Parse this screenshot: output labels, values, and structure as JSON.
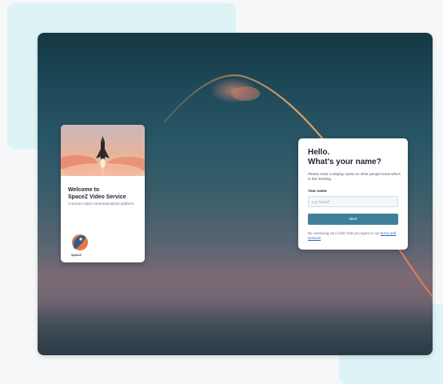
{
  "welcome": {
    "title_line1": "Welcome to",
    "title_line2": "SpaceZ Video Service",
    "subtitle": "A secure video communications platform.",
    "logo_text": "SpaceZ",
    "logo_icon": "rocket-logo-icon"
  },
  "name_form": {
    "heading_line1": "Hello.",
    "heading_line2": "What's your name?",
    "description": "Please enter a display name so other people know who's in the meeting",
    "field_label": "Your name",
    "placeholder": "e.g \"David\"",
    "value": "",
    "next_label": "Next",
    "consent_text": "By continuing you cofirm that you agree to our",
    "terms_link": "terms and services"
  },
  "colors": {
    "accent": "#3f7f98",
    "link": "#2b63c7",
    "backdrop": "#ddf3f6"
  }
}
